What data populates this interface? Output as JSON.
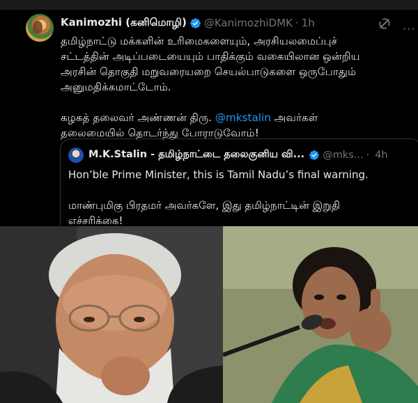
{
  "tweet": {
    "author_name": "Kanimozhi (கனிமொழி)",
    "handle": "@KanimozhiDMK",
    "separator": "·",
    "time": "1h",
    "body_lines": [
      "தமிழ்நாட்டு மக்களின் உரிமைகளையும், அரசியலமைப்புச்",
      "சட்டத்தின் அடிப்படையையும் பாதிக்கும் வகையிலான ஒன்றிய",
      "அரசின் தொகுதி மறுவரையறை செயல்பாடுகளை ஒருபோதும்",
      "அனுமதிக்கமாட்டோம்."
    ],
    "body_line5_prefix": "கழகத் தலைவர் அண்ணன் திரு. ",
    "mention": "@mkstalin",
    "body_line5_suffix": " அவர்கள்",
    "body_line6": "தலைமையில் தொடர்ந்து போராடுவோம்!",
    "more_icon_glyph": "···"
  },
  "quote": {
    "author_name": "M.K.Stalin - தமிழ்நாட்டை தலைகுனிய வி...",
    "handle": "@mks...",
    "separator": "·",
    "time": "4h",
    "line1": "Hon’ble Prime Minister, this is Tamil Nadu’s final warning.",
    "line2": "மாண்புமிகு பிரதமர் அவர்களே, இது தமிழ்நாட்டின் இறுதி",
    "line3": "எச்சரிக்கை!"
  },
  "colors": {
    "background": "#000000",
    "text": "#e7e9ea",
    "muted": "#71767b",
    "accent": "#1d9bf0",
    "border": "#2f3336"
  },
  "icons": {
    "verified": "verified-badge-icon",
    "grok": "grok-icon",
    "more": "more-options-icon"
  }
}
